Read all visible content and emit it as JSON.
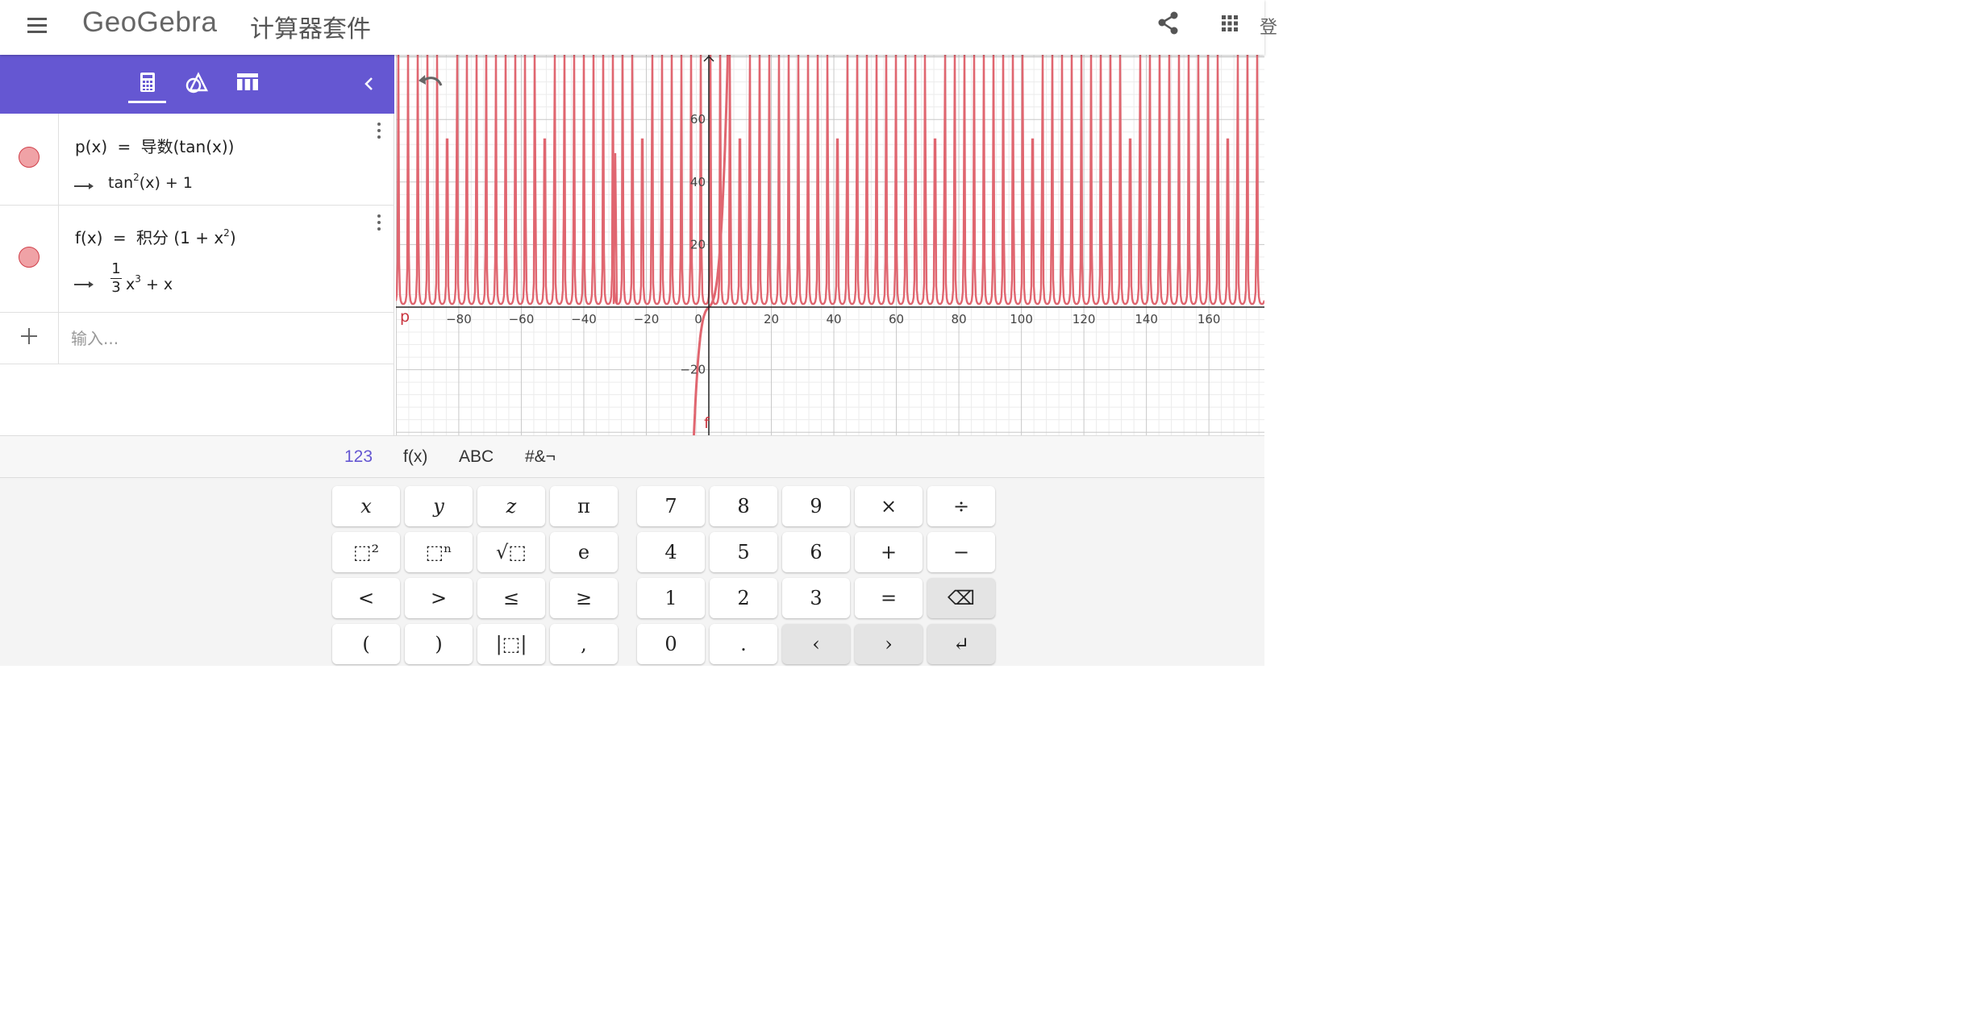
{
  "header": {
    "logo_text": "GeoGebra",
    "suite_title": "计算器套件",
    "edge_char": "登"
  },
  "colors": {
    "toolbar": "#6557d2",
    "graph_curve": "#e06670",
    "marble_fill": "#f0a2a6"
  },
  "toolbar_icons": [
    "calculator-icon",
    "geometry-icon",
    "table-icon",
    "collapse-chevron-icon"
  ],
  "algebra": {
    "rows": [
      {
        "input_head": "p(x)",
        "equals": "=",
        "input_body": "导数(tan(x))",
        "output_main": "tan",
        "output_sup": "2",
        "output_tail": "(x) + 1"
      },
      {
        "input_head": "f(x)",
        "equals": "=",
        "input_body": "积分 (1 + x",
        "input_sup": "2",
        "input_close": ")",
        "output_num": "1",
        "output_den": "3",
        "output_x": "x",
        "output_sup": "3",
        "output_tail": "+ x"
      }
    ],
    "input_placeholder": "输入..."
  },
  "graph": {
    "x_ticks": [
      "−80",
      "−60",
      "−40",
      "−20",
      "0",
      "20",
      "40",
      "60",
      "80",
      "100",
      "120",
      "140",
      "160"
    ],
    "y_ticks": [
      "60",
      "40",
      "20",
      "−20"
    ],
    "label_p": "p",
    "label_f": "f"
  },
  "keyboard": {
    "tabs": [
      "123",
      "f(x)",
      "ABC",
      "#&¬"
    ],
    "active_tab": "123",
    "left_keys": [
      [
        "x",
        "y",
        "z",
        "π"
      ],
      [
        "⬚²",
        "⬚ⁿ",
        "√⬚",
        "e"
      ],
      [
        "<",
        ">",
        "≤",
        "≥"
      ],
      [
        "(",
        ")",
        "|⬚|",
        ","
      ]
    ],
    "right_keys": [
      [
        "7",
        "8",
        "9",
        "×",
        "÷"
      ],
      [
        "4",
        "5",
        "6",
        "+",
        "−"
      ],
      [
        "1",
        "2",
        "3",
        "=",
        "⌫"
      ],
      [
        "0",
        ".",
        "‹",
        "›",
        "↵"
      ]
    ]
  }
}
